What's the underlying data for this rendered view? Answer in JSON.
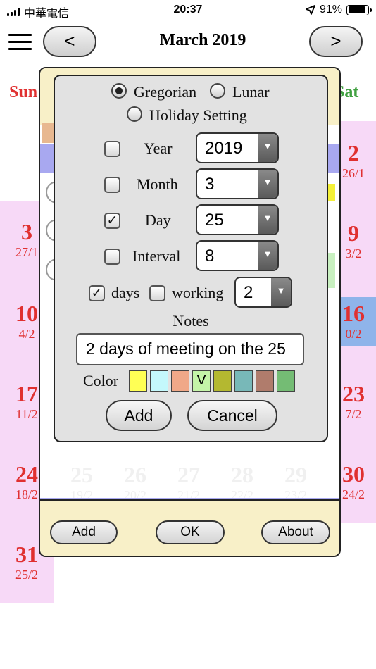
{
  "status_bar": {
    "carrier": "中華電信",
    "time": "20:37",
    "battery": "91%",
    "battery_level": 0.91
  },
  "header": {
    "prev_label": "<",
    "title": "March 2019",
    "next_label": ">"
  },
  "calendar": {
    "weekday_sun": "Sun",
    "weekday_sat": "Sat",
    "sun_cells": [
      {
        "day": "3",
        "lunar": "27/1"
      },
      {
        "day": "10",
        "lunar": "4/2"
      },
      {
        "day": "17",
        "lunar": "11/2"
      },
      {
        "day": "24",
        "lunar": "18/2"
      },
      {
        "day": "31",
        "lunar": "25/2"
      }
    ],
    "sat_cells": [
      {
        "day": "2",
        "lunar": "26/1"
      },
      {
        "day": "9",
        "lunar": "3/2"
      },
      {
        "day": "16",
        "lunar": "0/2"
      },
      {
        "day": "23",
        "lunar": "7/2"
      },
      {
        "day": "30",
        "lunar": "24/2"
      }
    ],
    "faded_row": [
      {
        "day": "25",
        "lunar": "19/2"
      },
      {
        "day": "26",
        "lunar": "20/2"
      },
      {
        "day": "27",
        "lunar": "21/2"
      },
      {
        "day": "28",
        "lunar": "22/2"
      },
      {
        "day": "29",
        "lunar": "23/2"
      }
    ]
  },
  "outer_dialog": {
    "add_label": "Add",
    "ok_label": "OK",
    "about_label": "About"
  },
  "modal": {
    "calendar_type": {
      "gregorian": "Gregorian",
      "lunar": "Lunar",
      "selected": "Gregorian"
    },
    "holiday_setting": "Holiday Setting",
    "rows": [
      {
        "label": "Year",
        "checked": false,
        "value": "2019"
      },
      {
        "label": "Month",
        "checked": false,
        "value": "3"
      },
      {
        "label": "Day",
        "checked": true,
        "value": "25"
      },
      {
        "label": "Interval",
        "checked": false,
        "value": "8"
      }
    ],
    "days_label": "days",
    "days_checked": true,
    "working_label": "working",
    "working_checked": false,
    "working_value": "2",
    "notes_label": "Notes",
    "notes_value": "2 days of meeting on the 25",
    "color_label": "Color",
    "colors": [
      "#ffff55",
      "#c4f8fc",
      "#f0a888",
      "#c4f4a8",
      "#b4b830",
      "#78b8b8",
      "#b07c6c",
      "#74bc74"
    ],
    "selected_color_mark": "V",
    "add_label": "Add",
    "cancel_label": "Cancel"
  }
}
